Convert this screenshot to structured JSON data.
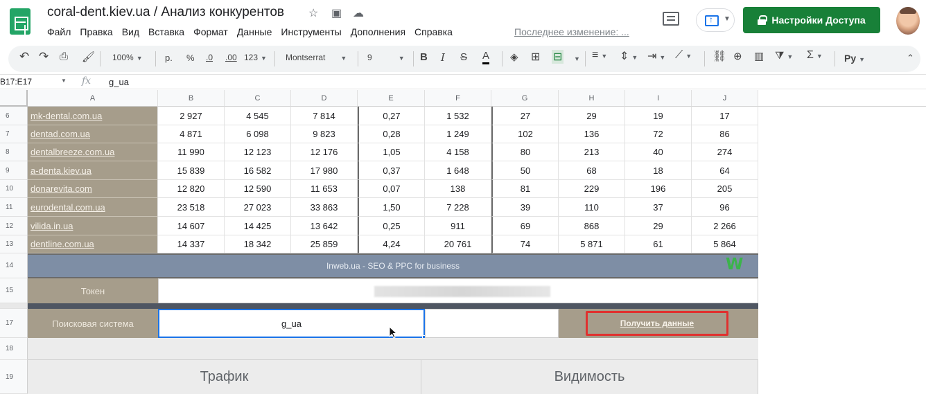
{
  "header": {
    "doc_title": "coral-dent.kiev.ua / Анализ конкурентов",
    "menu": [
      "Файл",
      "Правка",
      "Вид",
      "Вставка",
      "Формат",
      "Данные",
      "Инструменты",
      "Дополнения",
      "Справка"
    ],
    "last_edit": "Последнее изменение: ...",
    "share_label": "Настройки Доступа"
  },
  "toolbar": {
    "zoom": "100%",
    "currency": "р.",
    "percent": "%",
    "dec_less": ".0",
    "dec_more": ".00",
    "format_more": "123",
    "font": "Montserrat",
    "font_size": "9",
    "bold": "B",
    "italic": "I",
    "strike": "S",
    "text_color": "A",
    "input_tools": "Py"
  },
  "formula_bar": {
    "name_box": "B17:E17",
    "fx": "fx",
    "value": "g_ua"
  },
  "columns": [
    "A",
    "B",
    "C",
    "D",
    "E",
    "F",
    "G",
    "H",
    "I",
    "J"
  ],
  "rows": [
    {
      "num": "6",
      "site": "mk-dental.com.ua",
      "b": "2 927",
      "c": "4 545",
      "d": "7 814",
      "e": "0,27",
      "f": "1 532",
      "g": "27",
      "h": "29",
      "i": "19",
      "j": "17"
    },
    {
      "num": "7",
      "site": "dentad.com.ua",
      "b": "4 871",
      "c": "6 098",
      "d": "9 823",
      "e": "0,28",
      "f": "1 249",
      "g": "102",
      "h": "136",
      "i": "72",
      "j": "86"
    },
    {
      "num": "8",
      "site": "dentalbreeze.com.ua",
      "b": "11 990",
      "c": "12 123",
      "d": "12 176",
      "e": "1,05",
      "f": "4 158",
      "g": "80",
      "h": "213",
      "i": "40",
      "j": "274"
    },
    {
      "num": "9",
      "site": "a-denta.kiev.ua",
      "b": "15 839",
      "c": "16 582",
      "d": "17 980",
      "e": "0,37",
      "f": "1 648",
      "g": "50",
      "h": "68",
      "i": "18",
      "j": "64"
    },
    {
      "num": "10",
      "site": "donarevita.com",
      "b": "12 820",
      "c": "12 590",
      "d": "11 653",
      "e": "0,07",
      "f": "138",
      "g": "81",
      "h": "229",
      "i": "196",
      "j": "205"
    },
    {
      "num": "11",
      "site": "eurodental.com.ua",
      "b": "23 518",
      "c": "27 023",
      "d": "33 863",
      "e": "1,50",
      "f": "7 228",
      "g": "39",
      "h": "110",
      "i": "37",
      "j": "96"
    },
    {
      "num": "12",
      "site": "vilida.in.ua",
      "b": "14 607",
      "c": "14 425",
      "d": "13 642",
      "e": "0,25",
      "f": "911",
      "g": "69",
      "h": "868",
      "i": "29",
      "j": "2 266"
    },
    {
      "num": "13",
      "site": "dentline.com.ua",
      "b": "14 337",
      "c": "18 342",
      "d": "25 859",
      "e": "4,24",
      "f": "20 761",
      "g": "74",
      "h": "5 871",
      "i": "61",
      "j": "5 864"
    }
  ],
  "row_numbers": {
    "r14": "14",
    "r15": "15",
    "r17": "17",
    "r18": "18",
    "r19": "19"
  },
  "banner": "Inweb.ua - SEO & PPC for business",
  "banner_logo": "W",
  "token_label": "Токен",
  "engine_label": "Поисковая система",
  "engine_value": "g_ua",
  "get_data_button": "Получить данные",
  "sections": {
    "traffic": "Трафик",
    "visibility": "Видимость"
  },
  "colors": {
    "brand_green": "#188038",
    "beige": "#a69d8b",
    "banner": "#7e8ea5",
    "highlight_red": "#e0312f",
    "selection_blue": "#1a73e8"
  }
}
